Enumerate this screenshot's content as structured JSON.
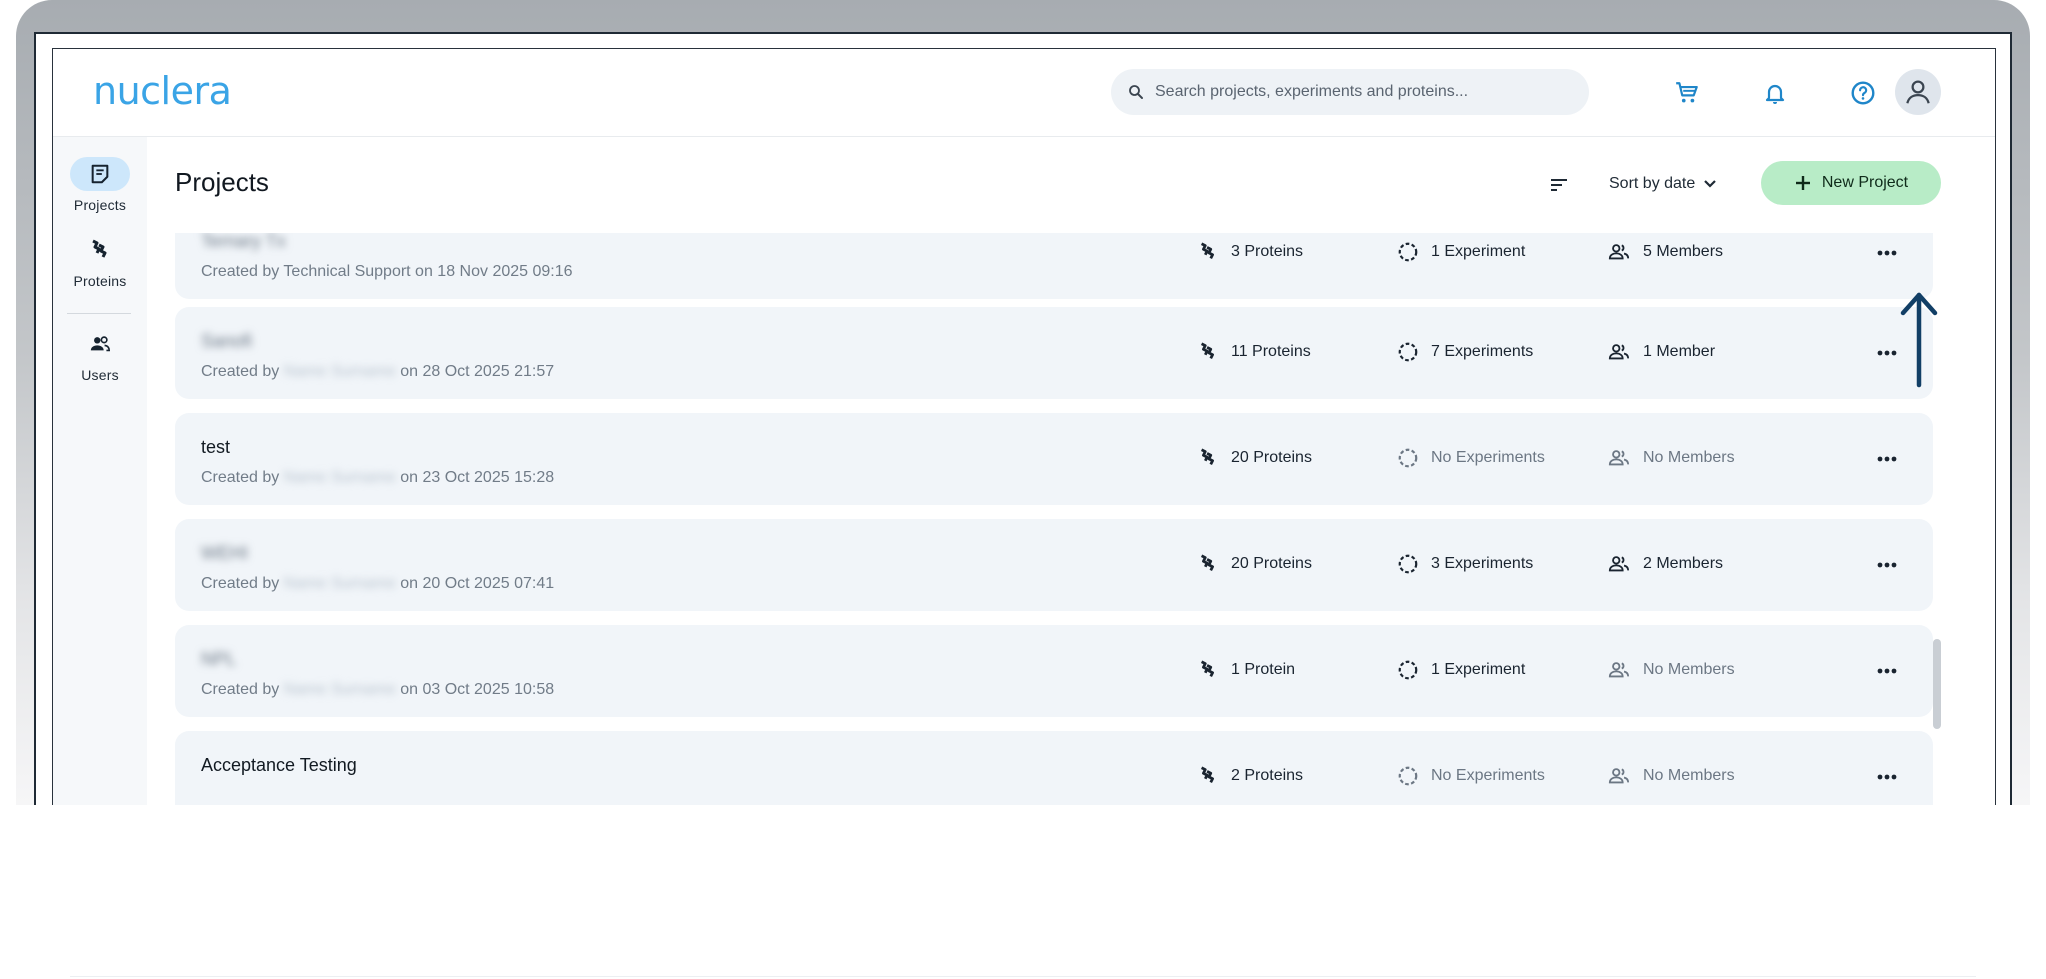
{
  "app": {
    "logo_text": "nuclera"
  },
  "search": {
    "placeholder": "Search projects, experiments and proteins..."
  },
  "header_icons": [
    "cart-icon",
    "bell-icon",
    "help-icon",
    "account-icon"
  ],
  "sidebar": {
    "items": [
      {
        "label": "Projects",
        "icon": "projects-icon",
        "active": true
      },
      {
        "label": "Proteins",
        "icon": "proteins-icon",
        "active": false
      },
      {
        "label": "Users",
        "icon": "users-icon",
        "active": false
      }
    ]
  },
  "main": {
    "title": "Projects",
    "sort_label": "Sort by date",
    "new_project_label": "New Project"
  },
  "projects": [
    {
      "name": "Ternary Tx",
      "created_prefix": "Created by ",
      "creator": "Technical Support",
      "creator_blurred": false,
      "name_blurred": true,
      "created_suffix": " on 18 Nov 2025 09:16",
      "proteins": "3 Proteins",
      "experiments": "1 Experiment",
      "members": "5 Members",
      "experiments_muted": false,
      "members_muted": false
    },
    {
      "name": "Sanofi",
      "created_prefix": "Created by ",
      "creator": "Name Surname",
      "creator_blurred": true,
      "name_blurred": true,
      "created_suffix": " on 28 Oct 2025 21:57",
      "proteins": "11 Proteins",
      "experiments": "7 Experiments",
      "members": "1 Member",
      "experiments_muted": false,
      "members_muted": false
    },
    {
      "name": "test",
      "created_prefix": "Created by ",
      "creator": "Name Surname",
      "creator_blurred": true,
      "name_blurred": false,
      "created_suffix": " on 23 Oct 2025 15:28",
      "proteins": "20 Proteins",
      "experiments": "No Experiments",
      "members": "No Members",
      "experiments_muted": true,
      "members_muted": true
    },
    {
      "name": "WEHI",
      "created_prefix": "Created by ",
      "creator": "Name Surname",
      "creator_blurred": true,
      "name_blurred": true,
      "created_suffix": " on 20 Oct 2025 07:41",
      "proteins": "20 Proteins",
      "experiments": "3 Experiments",
      "members": "2 Members",
      "experiments_muted": false,
      "members_muted": false
    },
    {
      "name": "NPL",
      "created_prefix": "Created by ",
      "creator": "Name Surname",
      "creator_blurred": true,
      "name_blurred": true,
      "created_suffix": " on 03 Oct 2025 10:58",
      "proteins": "1 Protein",
      "experiments": "1 Experiment",
      "members": "No Members",
      "experiments_muted": false,
      "members_muted": true
    },
    {
      "name": "Acceptance Testing",
      "created_prefix": "",
      "creator": "",
      "creator_blurred": false,
      "name_blurred": false,
      "created_suffix": "",
      "proteins": "2 Proteins",
      "experiments": "No Experiments",
      "members": "No Members",
      "experiments_muted": true,
      "members_muted": true
    }
  ],
  "colors": {
    "accent": "#3aa4e6",
    "new_button": "#b8ecc7",
    "row_bg": "#f1f5f9",
    "arrow": "#123f66"
  }
}
